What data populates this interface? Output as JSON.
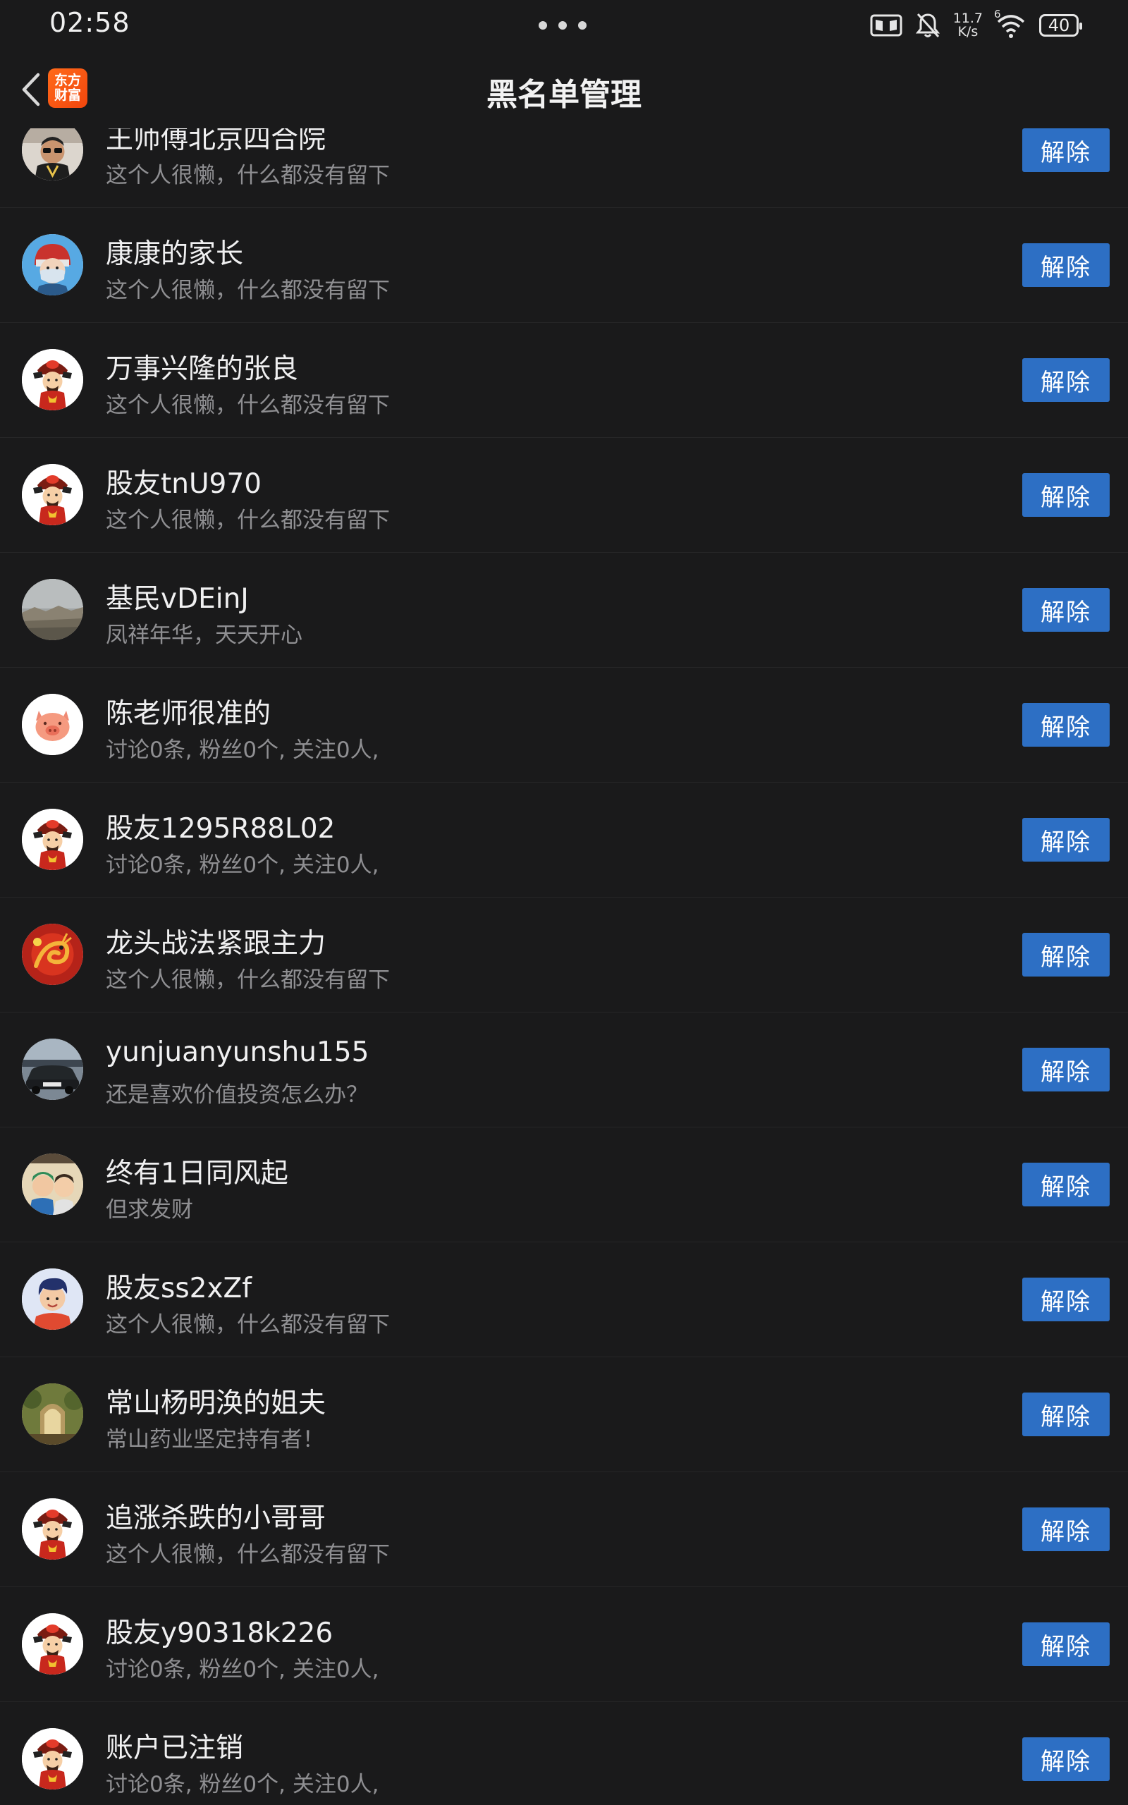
{
  "status_bar": {
    "time": "02:58",
    "net_speed_value": "11.7",
    "net_speed_unit": "K/s",
    "wifi_badge": "6",
    "battery": "40"
  },
  "header": {
    "back_icon": "chevron-left-icon",
    "logo_line1": "东方",
    "logo_line2": "财富",
    "title": "黑名单管理"
  },
  "remove_label": "解除",
  "blocked_users": [
    {
      "name": "王师傅北京四合院",
      "description": "这个人很懒，什么都没有留下",
      "avatar": "man-sunglasses-photo"
    },
    {
      "name": "康康的家长",
      "description": "这个人很懒，什么都没有留下",
      "avatar": "cartoon-masked-hero"
    },
    {
      "name": "万事兴隆的张良",
      "description": "这个人很懒，什么都没有留下",
      "avatar": "god-of-wealth"
    },
    {
      "name": "股友tnU970",
      "description": "这个人很懒，什么都没有留下",
      "avatar": "god-of-wealth"
    },
    {
      "name": "基民vDEinJ",
      "description": "凤祥年华，天天开心",
      "avatar": "landscape-photo"
    },
    {
      "name": "陈老师很准的",
      "description": "讨论0条, 粉丝0个, 关注0人,",
      "avatar": "pink-pig"
    },
    {
      "name": "股友1295R88L02",
      "description": "讨论0条, 粉丝0个, 关注0人,",
      "avatar": "god-of-wealth"
    },
    {
      "name": "龙头战法紧跟主力",
      "description": "这个人很懒，什么都没有留下",
      "avatar": "red-dragon"
    },
    {
      "name": "yunjuanyunshu155",
      "description": "还是喜欢价值投资怎么办？",
      "avatar": "car-photo"
    },
    {
      "name": "终有1日同风起",
      "description": "但求发财",
      "avatar": "anime-characters"
    },
    {
      "name": "股友ss2xZf",
      "description": "这个人很懒，什么都没有留下",
      "avatar": "cartoon-boy"
    },
    {
      "name": "常山杨明涣的姐夫",
      "description": "常山药业坚定持有者！",
      "avatar": "garden-photo"
    },
    {
      "name": "追涨杀跌的小哥哥",
      "description": "这个人很懒，什么都没有留下",
      "avatar": "god-of-wealth"
    },
    {
      "name": "股友y90318k226",
      "description": "讨论0条, 粉丝0个, 关注0人,",
      "avatar": "god-of-wealth"
    },
    {
      "name": "账户已注销",
      "description": "讨论0条, 粉丝0个, 关注0人,",
      "avatar": "god-of-wealth"
    }
  ]
}
